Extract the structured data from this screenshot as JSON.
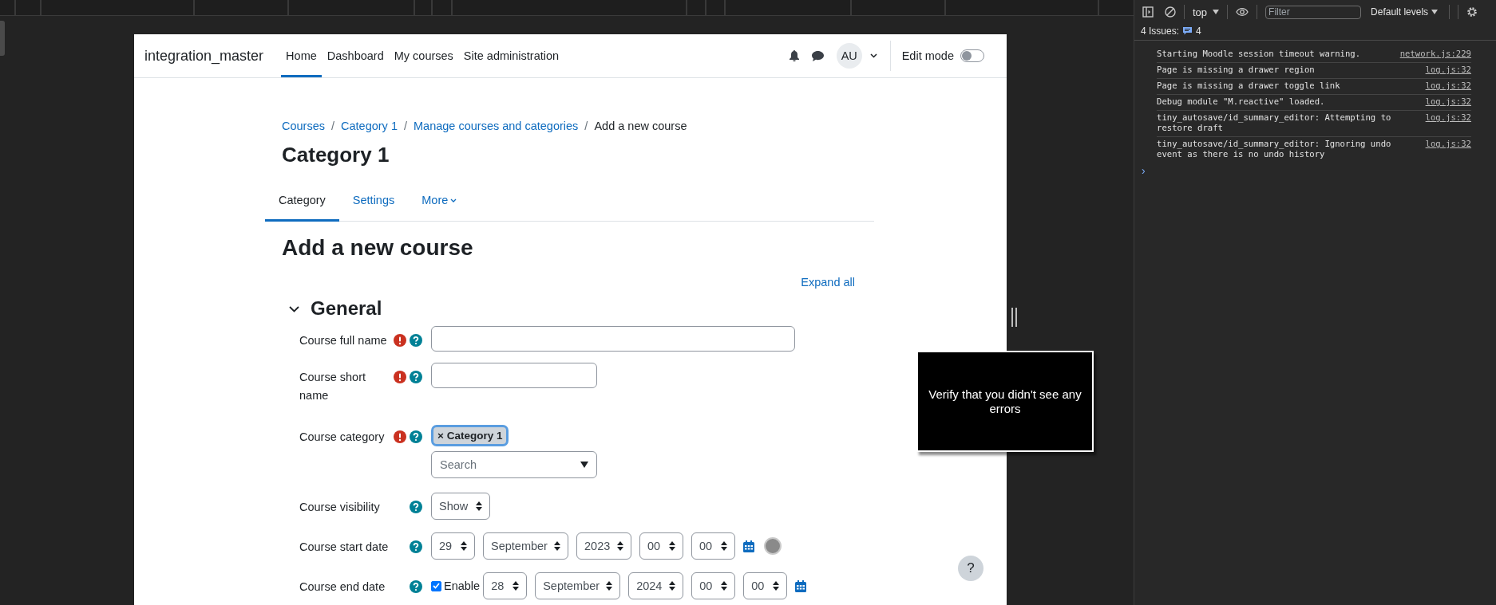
{
  "site_name": "integration_master",
  "nav": [
    {
      "label": "Home",
      "selected": true
    },
    {
      "label": "Dashboard",
      "selected": false
    },
    {
      "label": "My courses",
      "selected": false
    },
    {
      "label": "Site administration",
      "selected": false
    }
  ],
  "user_initials": "AU",
  "edit_mode": {
    "label": "Edit mode",
    "on": false
  },
  "breadcrumb": [
    {
      "label": "Courses",
      "link": true
    },
    {
      "label": "Category 1",
      "link": true
    },
    {
      "label": "Manage courses and categories",
      "link": true
    },
    {
      "label": "Add a new course",
      "link": false
    }
  ],
  "breadcrumb_separator": "/",
  "category_title": "Category 1",
  "tabs": [
    {
      "label": "Category",
      "selected": true,
      "dropdown": false
    },
    {
      "label": "Settings",
      "selected": false,
      "dropdown": false
    },
    {
      "label": "More",
      "selected": false,
      "dropdown": true
    }
  ],
  "page_title": "Add a new course",
  "expand_all": "Expand all",
  "section": {
    "title": "General",
    "expanded": true
  },
  "fields": [
    {
      "kind": "text_long",
      "label": "Course full name",
      "required": true
    },
    {
      "kind": "text_short",
      "label": "Course short name",
      "required": true
    },
    {
      "kind": "autocomplete",
      "label": "Course category",
      "required": true,
      "tag": "× Category 1",
      "placeholder": "Search"
    },
    {
      "kind": "select",
      "label": "Course visibility",
      "required": false,
      "value": "Show"
    },
    {
      "kind": "date",
      "label": "Course start date",
      "required": false,
      "parts": [
        "29",
        "September",
        "2023",
        "00",
        "00"
      ]
    },
    {
      "kind": "date",
      "label": "Course end date",
      "required": false,
      "enable": {
        "label": "Enable",
        "checked": true
      },
      "parts": [
        "28",
        "September",
        "2024",
        "00",
        "00"
      ]
    }
  ],
  "help_button": "?",
  "overlay": {
    "text": "Verify that you didn't see any errors"
  },
  "devtools": {
    "context": "top",
    "filter_placeholder": "Filter",
    "levels": "Default levels",
    "issues_label": "4 Issues:",
    "issues_count": "4",
    "messages": [
      {
        "text": "Starting Moodle session timeout warning.",
        "source": "network.js:229"
      },
      {
        "text": "Page is missing a drawer region",
        "source": "log.js:32"
      },
      {
        "text": "Page is missing a drawer toggle link",
        "source": "log.js:32"
      },
      {
        "text": "Debug module \"M.reactive\" loaded.",
        "source": "log.js:32"
      },
      {
        "text": "tiny_autosave/id_summary_editor: Attempting to restore draft",
        "source": "log.js:32"
      },
      {
        "text": "tiny_autosave/id_summary_editor: Ignoring undo event as there is no undo history",
        "source": "log.js:32"
      }
    ],
    "prompt": "›"
  }
}
